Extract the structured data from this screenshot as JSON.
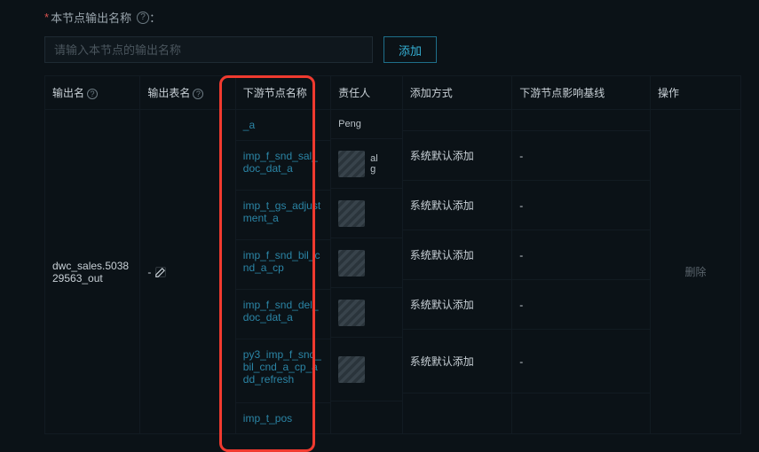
{
  "field": {
    "required": "*",
    "label": "本节点输出名称",
    "colon": "："
  },
  "input": {
    "placeholder": "请输入本节点的输出名称",
    "add_label": "添加"
  },
  "columns": {
    "output_name": "输出名",
    "output_table": "输出表名",
    "downstream": "下游节点名称",
    "owner": "责任人",
    "add_type": "添加方式",
    "baseline": "下游节点影响基线",
    "action": "操作"
  },
  "row": {
    "output_name": "dwc_sales.503829563_out",
    "output_table": "-"
  },
  "downstream_head": "_a",
  "owner_head": "Peng",
  "downstream_items": [
    "imp_f_snd_sal_doc_dat_a",
    "imp_t_gs_adjustment_a",
    "imp_f_snd_bil_cnd_a_cp",
    "imp_f_snd_del_doc_dat_a",
    "py3_imp_f_snd_bil_cnd_a_cp_add_refresh"
  ],
  "downstream_tail": "imp_t_pos",
  "add_type_value": "系统默认添加",
  "baseline_value": "-",
  "owner_redacted_a": "al",
  "owner_redacted_b": "g",
  "action_delete": "删除"
}
